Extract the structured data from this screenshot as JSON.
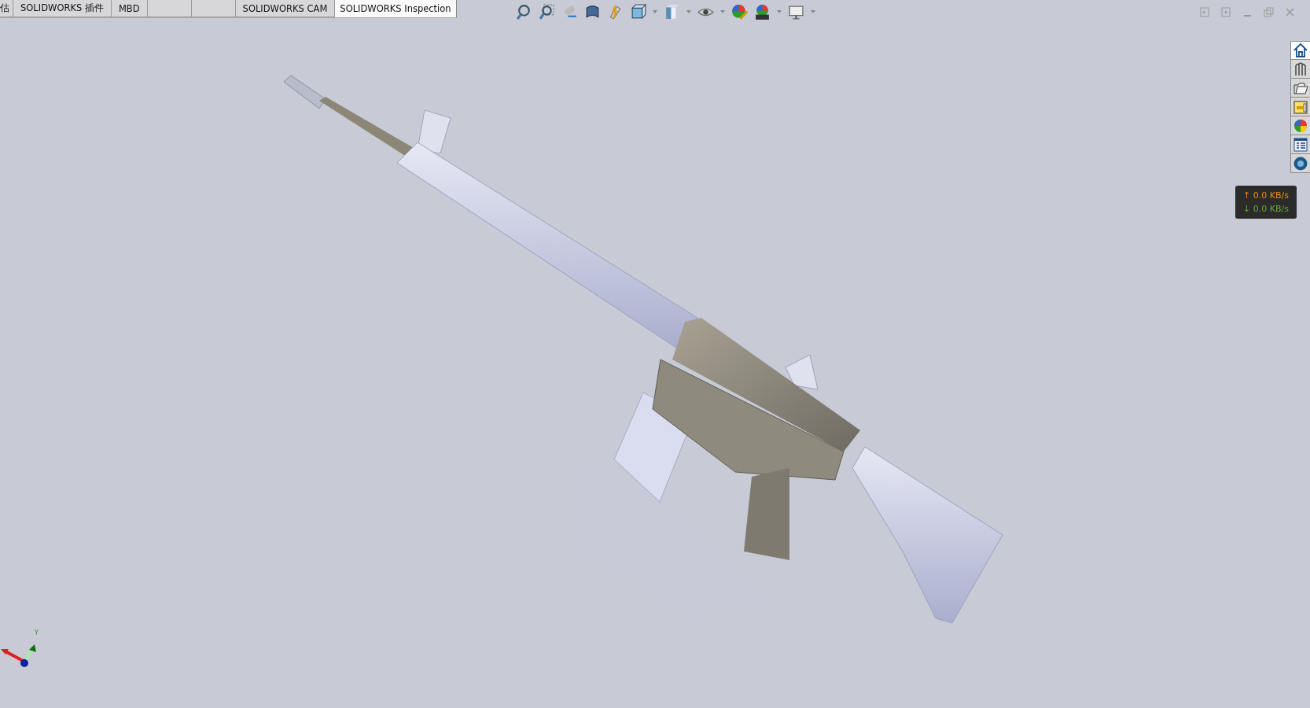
{
  "ribbon_tabs": [
    {
      "label": "估",
      "selected": false
    },
    {
      "label": "SOLIDWORKS 插件",
      "selected": false
    },
    {
      "label": "MBD",
      "selected": false
    },
    {
      "selected": false
    },
    {
      "selected": false
    },
    {
      "label": "SOLIDWORKS CAM",
      "selected": false
    },
    {
      "label": "SOLIDWORKS Inspection",
      "selected": true
    }
  ],
  "network_speed": {
    "upload_arrow": "↑",
    "upload": "0.0 KB/s",
    "download_arrow": "↓",
    "download": "0.0 KB/s"
  },
  "axis_triad": {
    "y_label": "Y"
  }
}
